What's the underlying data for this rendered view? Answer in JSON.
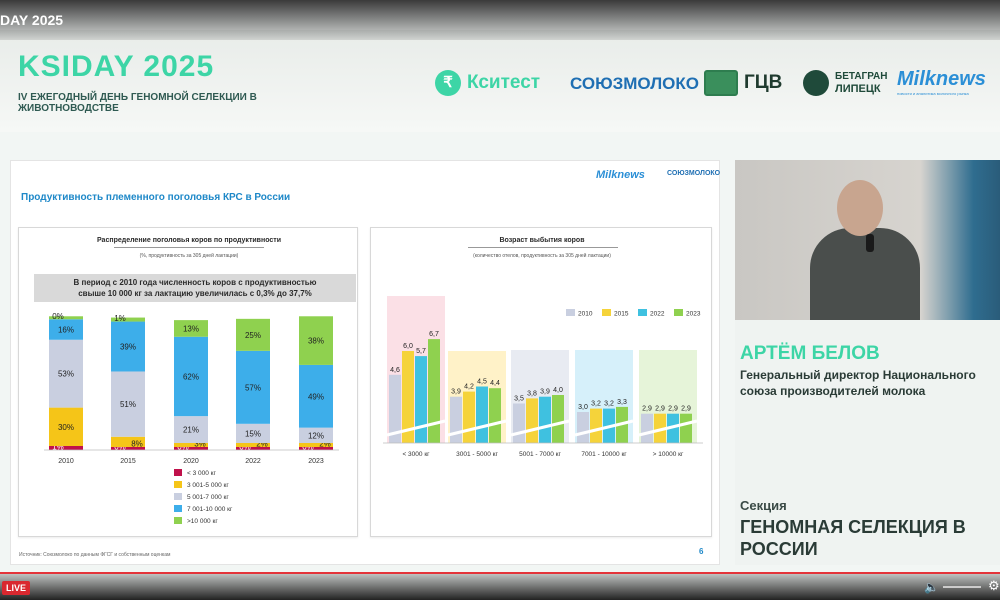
{
  "video": {
    "title_fragment": "DAY 2025",
    "live_label": "LIVE"
  },
  "event": {
    "title": "KSIDAY 2025",
    "subtitle": "IV ЕЖЕГОДНЫЙ ДЕНЬ ГЕНОМНОЙ СЕЛЕКЦИИ В ЖИВОТНОВОДСТВЕ"
  },
  "partners": {
    "ksitest": "Кситест",
    "soyuzmoloko": "СОЮЗМОЛОКО",
    "gcv": "ГЦВ",
    "betagran": "БЕТАГРАН",
    "lipetsk": "ЛИПЕЦК",
    "milknews": "Milknews",
    "milknews_tagline": "новости и аналитика молочного рынка"
  },
  "slide": {
    "title": "Продуктивность племенного поголовья КРС в России",
    "source": "Источник: Союзмолоко по данным ФГСГ и собственным оценкам",
    "page_number": "6",
    "logo_milknews": "Milknews",
    "logo_soyuz": "СОЮЗМОЛОКО",
    "left": {
      "title": "Распределение поголовья коров по продуктивности",
      "subtitle": "(%, продуктивность за 305 дней лактации)",
      "callout": "В период с 2010 года численность коров с продуктивностью свыше 10 000 кг за лактацию увеличилась с 0,3% до 37,7%"
    },
    "right": {
      "title": "Возраст выбытия коров",
      "subtitle": "(количество отелов, продуктивность за 305 дней лактации)"
    }
  },
  "speaker": {
    "name": "АРТЁМ БЕЛОВ",
    "role": "Генеральный директор Национального союза производителей молока",
    "section_label": "Секция",
    "section_name": "ГЕНОМНАЯ СЕЛЕКЦИЯ В РОССИИ"
  },
  "colors": {
    "accent": "#3dd5a6",
    "c1": "#c0114b",
    "c2": "#f5c518",
    "c3": "#c9cfe0",
    "c4": "#3daeea",
    "c5": "#8fd14f"
  },
  "chart_data": [
    {
      "type": "bar",
      "stacked": true,
      "title": "Распределение поголовья коров по продуктивности",
      "subtitle": "(%, продуктивность за 305 дней лактации)",
      "categories": [
        "2010",
        "2015",
        "2020",
        "2022",
        "2023"
      ],
      "ylim": [
        0,
        100
      ],
      "legend_position": "bottom",
      "series": [
        {
          "name": "< 3 000 кг",
          "color": "#c0114b",
          "values": [
            1,
            0,
            0,
            0,
            0
          ]
        },
        {
          "name": "3 001-5 000 кг",
          "color": "#f5c518",
          "values": [
            30,
            8,
            3,
            2,
            2
          ]
        },
        {
          "name": "5 001-7 000 кг",
          "color": "#c9cfe0",
          "values": [
            53,
            51,
            21,
            15,
            12
          ]
        },
        {
          "name": "7 001-10 000 кг",
          "color": "#3daeea",
          "values": [
            16,
            39,
            62,
            57,
            49
          ]
        },
        {
          "name": ">10 000 кг",
          "color": "#8fd14f",
          "values": [
            0,
            1,
            13,
            25,
            38
          ]
        }
      ]
    },
    {
      "type": "bar",
      "title": "Возраст выбытия коров",
      "subtitle": "(количество отелов, продуктивность за 305 дней лактации)",
      "categories": [
        "< 3000 кг",
        "3001 - 5000 кг",
        "5001 - 7000 кг",
        "7001 - 10000 кг",
        "> 10000 кг"
      ],
      "legend_position": "top-right",
      "series": [
        {
          "name": "2010",
          "color": "#c9cfe0",
          "values": [
            4.6,
            3.9,
            3.5,
            3.0,
            2.9
          ],
          "labels": [
            "4,6",
            "3,9",
            "3,5",
            "3,0",
            "2,9"
          ]
        },
        {
          "name": "2015",
          "color": "#f5d33a",
          "values": [
            6.0,
            4.2,
            3.8,
            3.2,
            2.9
          ],
          "labels": [
            "6,0",
            "4,2",
            "3,8",
            "3,2",
            "2,9"
          ]
        },
        {
          "name": "2022",
          "color": "#3fc1e0",
          "values": [
            5.7,
            4.5,
            3.9,
            3.2,
            2.9
          ],
          "labels": [
            "5,7",
            "4,5",
            "3,9",
            "3,2",
            "2,9"
          ]
        },
        {
          "name": "2023",
          "color": "#8fd14f",
          "values": [
            6.7,
            4.4,
            4.0,
            3.3,
            2.9
          ],
          "labels": [
            "6,7",
            "4,4",
            "4,0",
            "3,3",
            "2,9"
          ]
        }
      ],
      "group_backgrounds": [
        "#fbe0e6",
        "#fff2c8",
        "#e8ebf2",
        "#d6f0fa",
        "#e6f4d9"
      ]
    }
  ]
}
